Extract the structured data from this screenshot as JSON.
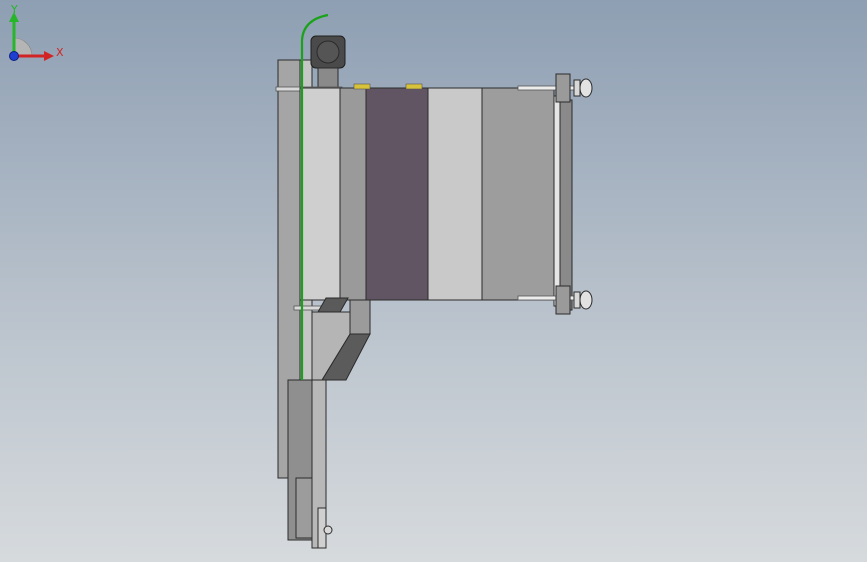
{
  "viewport": {
    "background_top": "#8e9fb3",
    "background_bottom": "#d6dadd"
  },
  "model": {
    "colors": {
      "frame_dark": "#7c7c7c",
      "frame_light": "#bdbdbd",
      "panel_light": "#cfcfcf",
      "panel_mid": "#9a9a9a",
      "panel_purple": "#625563",
      "cable": "#1aa21a",
      "motor": "#4a4a4a",
      "highlight_yellow": "#d7c23a",
      "outline": "#2b2b2b"
    },
    "parts": [
      "mounting-plate",
      "motor",
      "cable",
      "clamp-block",
      "purple-insert",
      "guide-rods",
      "end-plate",
      "chute",
      "bracket"
    ]
  },
  "triad": {
    "x_label": "X",
    "y_label": "Y",
    "x_color": "#d22424",
    "y_color": "#27b52a",
    "z_color": "#1f3fd1"
  }
}
